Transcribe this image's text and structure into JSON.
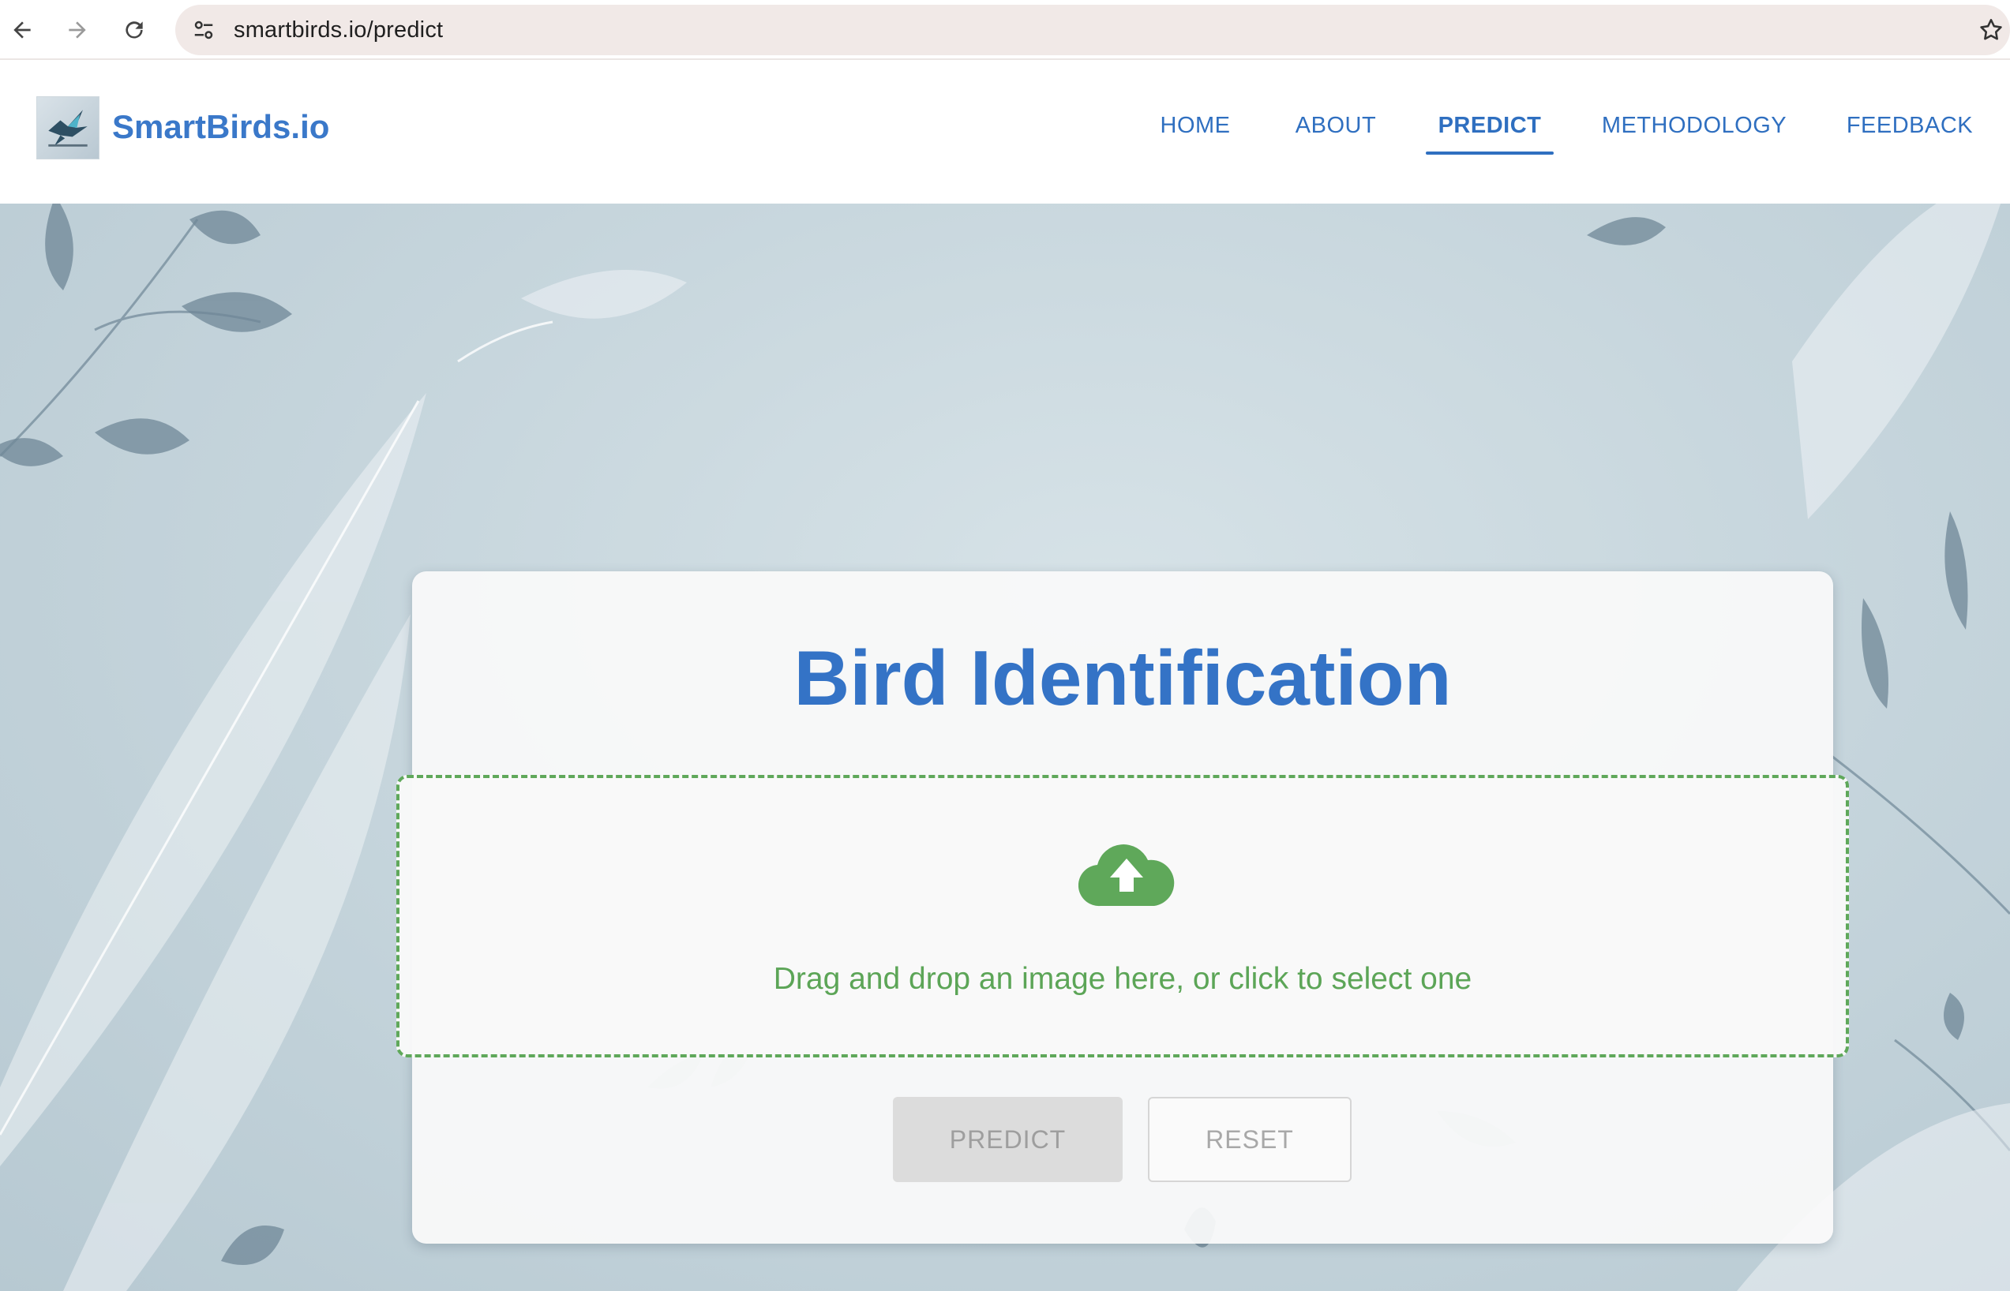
{
  "browser": {
    "url": "smartbirds.io/predict",
    "back_icon": "arrow-left-icon",
    "forward_icon": "arrow-right-icon",
    "reload_icon": "reload-icon",
    "site_info_icon": "tune-icon",
    "bookmark_icon": "star-icon"
  },
  "header": {
    "brand_name": "SmartBirds.io",
    "nav": [
      {
        "label": "HOME"
      },
      {
        "label": "ABOUT"
      },
      {
        "label": "PREDICT",
        "active": true
      },
      {
        "label": "METHODOLOGY"
      },
      {
        "label": "FEEDBACK"
      }
    ]
  },
  "main": {
    "title": "Bird Identification",
    "dropzone": {
      "text": "Drag and drop an image here, or click to select one",
      "icon": "cloud-upload-icon"
    },
    "buttons": {
      "predict": "PREDICT",
      "reset": "RESET"
    }
  },
  "colors": {
    "brand_blue": "#3a78c9",
    "dropzone_green": "#5fa85a",
    "omnibox": "#f1e9e7"
  }
}
